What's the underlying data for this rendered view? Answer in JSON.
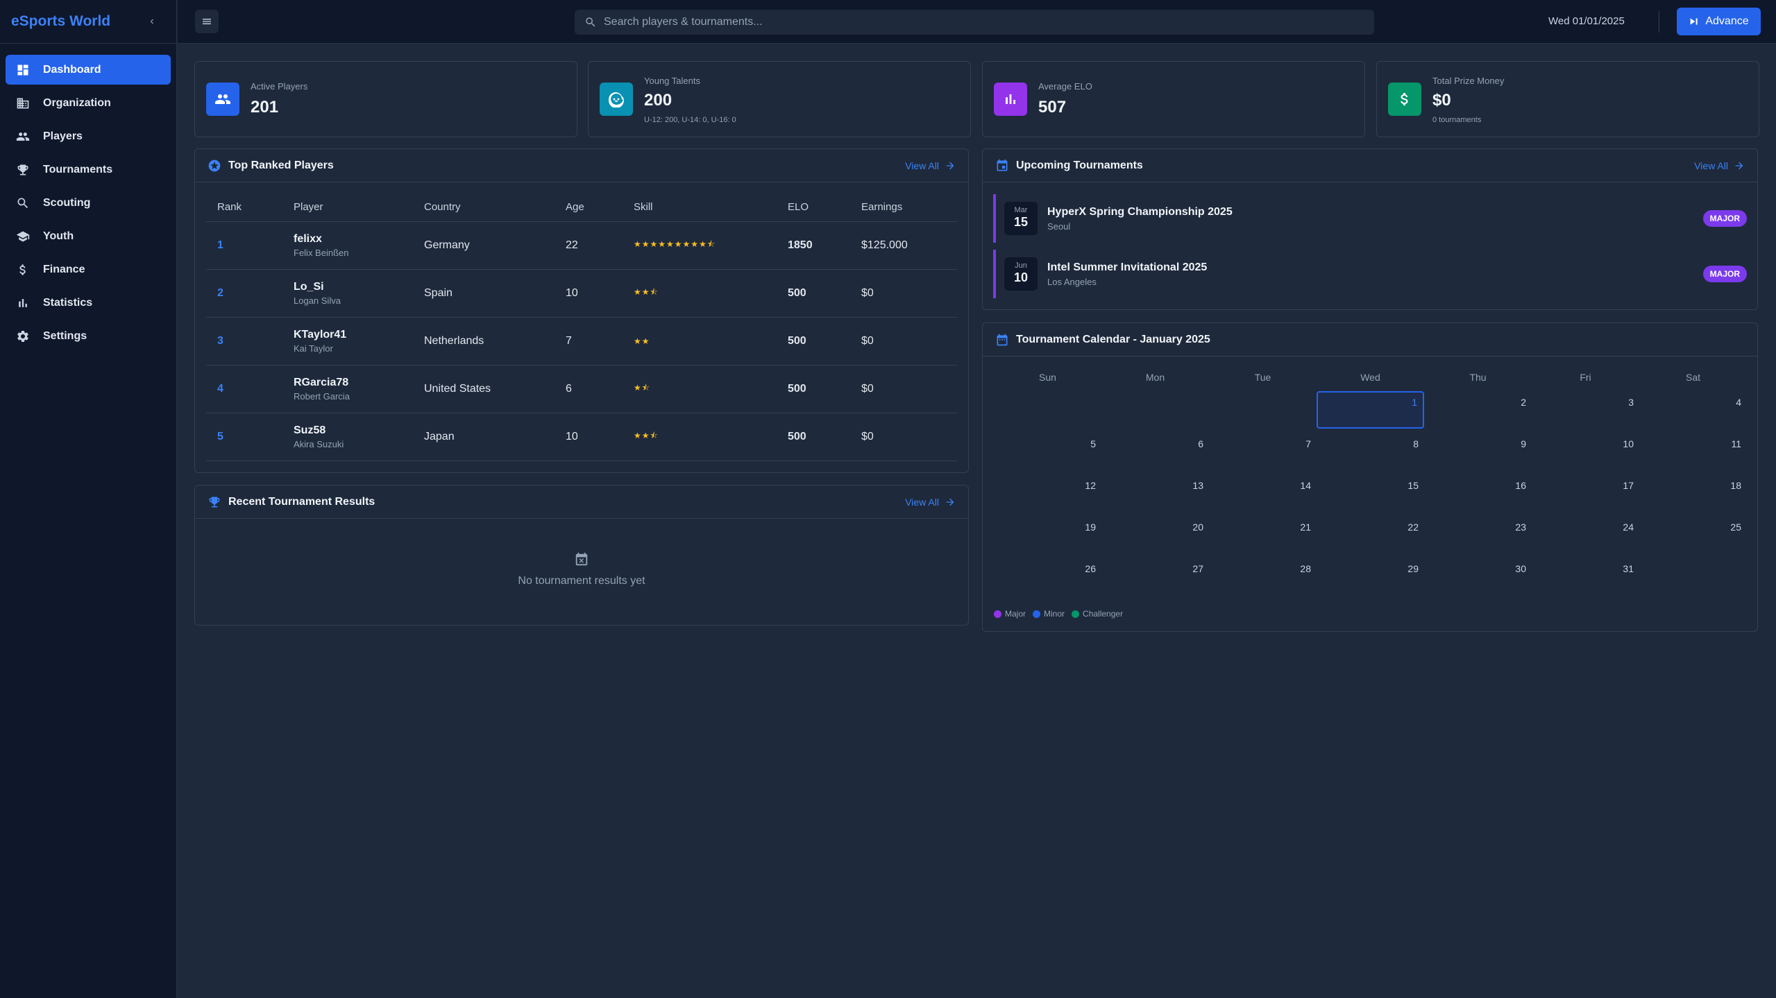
{
  "sidebar": {
    "brand": "eSports World",
    "items": [
      {
        "label": "Dashboard",
        "icon": "dashboard-icon",
        "active": true
      },
      {
        "label": "Organization",
        "icon": "building-icon"
      },
      {
        "label": "Players",
        "icon": "people-icon"
      },
      {
        "label": "Tournaments",
        "icon": "trophy-icon"
      },
      {
        "label": "Scouting",
        "icon": "search-icon"
      },
      {
        "label": "Youth",
        "icon": "graduation-cap-icon"
      },
      {
        "label": "Finance",
        "icon": "dollar-icon"
      },
      {
        "label": "Statistics",
        "icon": "bar-chart-icon"
      },
      {
        "label": "Settings",
        "icon": "gear-icon"
      }
    ]
  },
  "topbar": {
    "search_placeholder": "Search players & tournaments...",
    "date": "Wed 01/01/2025",
    "advance_label": "Advance"
  },
  "stats": [
    {
      "label": "Active Players",
      "value": "201",
      "color": "#2563eb",
      "icon": "people-icon"
    },
    {
      "label": "Young Talents",
      "value": "200",
      "sub": "U-12: 200, U-14: 0, U-16: 0",
      "color": "#0891b2",
      "icon": "baby-face-icon"
    },
    {
      "label": "Average ELO",
      "value": "507",
      "color": "#9333ea",
      "icon": "bar-chart-icon"
    },
    {
      "label": "Total Prize Money",
      "value": "$0",
      "sub": "0 tournaments",
      "color": "#059669",
      "icon": "dollar-icon"
    }
  ],
  "top_players": {
    "title": "Top Ranked Players",
    "view_all": "View All",
    "columns": [
      "Rank",
      "Player",
      "Country",
      "Age",
      "Skill",
      "ELO",
      "Earnings"
    ],
    "rows": [
      {
        "rank": "1",
        "tag": "felixx",
        "name": "Felix Beinßen",
        "country": "Germany",
        "age": "22",
        "skill": "★★★★★★★★★⯪",
        "elo": "1850",
        "earnings": "$125.000"
      },
      {
        "rank": "2",
        "tag": "Lo_Si",
        "name": "Logan Silva",
        "country": "Spain",
        "age": "10",
        "skill": "★★⯪",
        "elo": "500",
        "earnings": "$0"
      },
      {
        "rank": "3",
        "tag": "KTaylor41",
        "name": "Kai Taylor",
        "country": "Netherlands",
        "age": "7",
        "skill": "★★",
        "elo": "500",
        "earnings": "$0"
      },
      {
        "rank": "4",
        "tag": "RGarcia78",
        "name": "Robert Garcia",
        "country": "United States",
        "age": "6",
        "skill": "★⯪",
        "elo": "500",
        "earnings": "$0"
      },
      {
        "rank": "5",
        "tag": "Suz58",
        "name": "Akira Suzuki",
        "country": "Japan",
        "age": "10",
        "skill": "★★⯪",
        "elo": "500",
        "earnings": "$0"
      }
    ]
  },
  "recent_results": {
    "title": "Recent Tournament Results",
    "view_all": "View All",
    "empty": "No tournament results yet"
  },
  "upcoming": {
    "title": "Upcoming Tournaments",
    "view_all": "View All",
    "items": [
      {
        "month": "Mar",
        "day": "15",
        "name": "HyperX Spring Championship 2025",
        "location": "Seoul",
        "badge": "MAJOR"
      },
      {
        "month": "Jun",
        "day": "10",
        "name": "Intel Summer Invitational 2025",
        "location": "Los Angeles",
        "badge": "MAJOR"
      }
    ]
  },
  "calendar": {
    "title": "Tournament Calendar - January 2025",
    "weekdays": [
      "Sun",
      "Mon",
      "Tue",
      "Wed",
      "Thu",
      "Fri",
      "Sat"
    ],
    "leading_blanks": 3,
    "days": 31,
    "today": 1,
    "legend": [
      {
        "label": "Major",
        "color": "#9333ea"
      },
      {
        "label": "Minor",
        "color": "#2563eb"
      },
      {
        "label": "Challenger",
        "color": "#059669"
      }
    ]
  }
}
